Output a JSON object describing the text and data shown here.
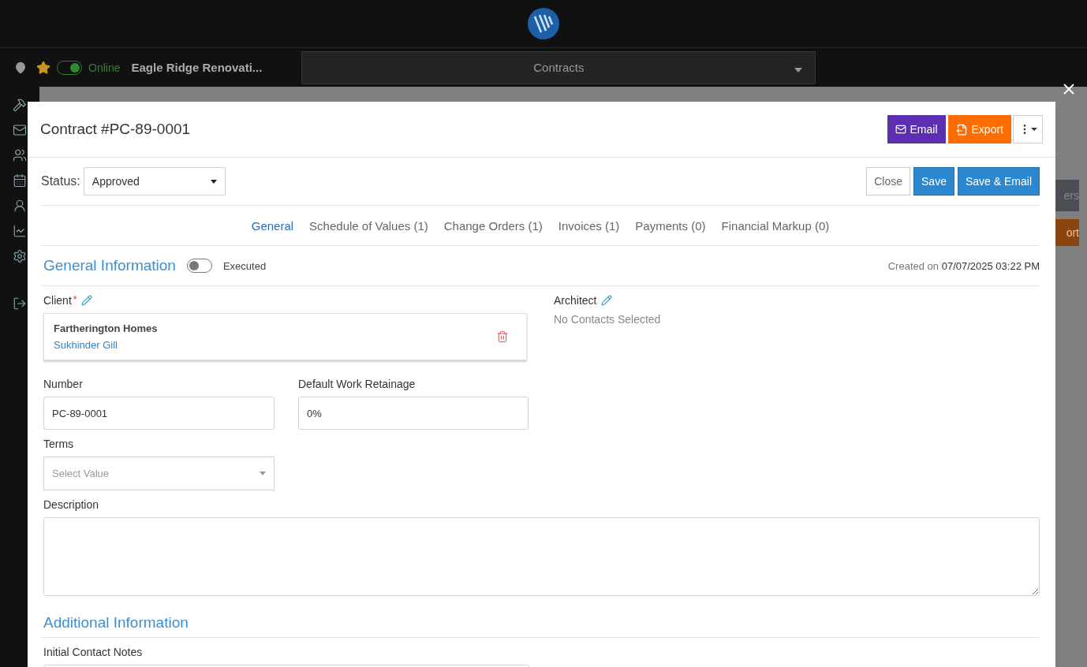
{
  "topbar": {
    "online": {
      "label": "Online",
      "on": true
    },
    "favorite": true,
    "project": "Eagle Ridge Renovati...",
    "module": "Contracts"
  },
  "background": {
    "fragments": [
      {
        "kind": "dark",
        "text": "ers"
      },
      {
        "kind": "orange",
        "text": "ort"
      }
    ]
  },
  "modal": {
    "title": "Contract #PC-89-0001",
    "actions": [
      {
        "kind": "email",
        "label": "Email"
      },
      {
        "kind": "export",
        "label": "Export"
      }
    ],
    "status": {
      "label": "Status:",
      "value": "Approved"
    },
    "buttons": [
      {
        "kind": "default",
        "label": "Close"
      },
      {
        "kind": "primary",
        "label": "Save"
      },
      {
        "kind": "primary",
        "label": "Save & Email"
      }
    ],
    "tabs": [
      {
        "label": "General",
        "selected": true
      },
      {
        "label": "Schedule of Values (1)",
        "selected": false
      },
      {
        "label": "Change Orders (1)",
        "selected": false
      },
      {
        "label": "Invoices (1)",
        "selected": false
      },
      {
        "label": "Payments (0)",
        "selected": false
      },
      {
        "label": "Financial Markup (0)",
        "selected": false
      }
    ],
    "general": {
      "title": "General Information",
      "executed": {
        "label": "Executed",
        "on": false
      },
      "created_label": "Created on",
      "created_value": "07/07/2025 03:22 PM",
      "client": {
        "label": "Client",
        "required_mark": "*",
        "company": "Fartherington Homes",
        "contact": "Sukhinder Gill"
      },
      "architect": {
        "label": "Architect",
        "empty": "No Contacts Selected"
      },
      "number": {
        "label": "Number",
        "value": "PC-89-0001"
      },
      "retainage": {
        "label": "Default Work Retainage",
        "value": "0%"
      },
      "terms": {
        "label": "Terms",
        "placeholder": "Select Value"
      },
      "description": {
        "label": "Description"
      }
    },
    "additional": {
      "title": "Additional Information",
      "notes_label": "Initial Contact Notes"
    }
  }
}
